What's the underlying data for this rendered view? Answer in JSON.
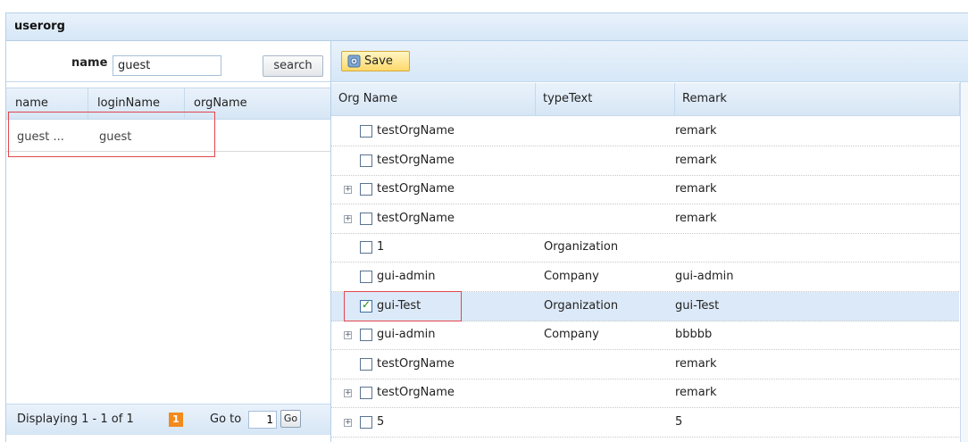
{
  "panel": {
    "title": "userorg"
  },
  "left": {
    "search": {
      "label": "name",
      "value": "guest",
      "button": "search"
    },
    "columns": [
      "name",
      "loginName",
      "orgName"
    ],
    "rows": [
      {
        "name": "guest ...",
        "loginName": "guest",
        "orgName": ""
      }
    ],
    "pager": {
      "displaying": "Displaying 1 - 1 of 1",
      "page": "1",
      "goto_label": "Go to",
      "goto_value": "1",
      "go_button": "Go"
    }
  },
  "right": {
    "toolbar": {
      "save_label": "Save"
    },
    "columns": [
      "Org Name",
      "typeText",
      "Remark"
    ],
    "rows": [
      {
        "name": "testOrgName",
        "type": "",
        "remark": "remark",
        "expandable": false,
        "checked": false
      },
      {
        "name": "testOrgName",
        "type": "",
        "remark": "remark",
        "expandable": false,
        "checked": false
      },
      {
        "name": "testOrgName",
        "type": "",
        "remark": "remark",
        "expandable": true,
        "checked": false
      },
      {
        "name": "testOrgName",
        "type": "",
        "remark": "remark",
        "expandable": true,
        "checked": false
      },
      {
        "name": "1",
        "type": "Organization",
        "remark": "",
        "expandable": false,
        "checked": false
      },
      {
        "name": "gui-admin",
        "type": "Company",
        "remark": "gui-admin",
        "expandable": false,
        "checked": false
      },
      {
        "name": "gui-Test",
        "type": "Organization",
        "remark": "gui-Test",
        "expandable": false,
        "checked": true
      },
      {
        "name": "gui-admin",
        "type": "Company",
        "remark": "bbbbb",
        "expandable": true,
        "checked": false
      },
      {
        "name": "testOrgName",
        "type": "",
        "remark": "remark",
        "expandable": false,
        "checked": false
      },
      {
        "name": "testOrgName",
        "type": "",
        "remark": "remark",
        "expandable": true,
        "checked": false
      },
      {
        "name": "5",
        "type": "",
        "remark": "5",
        "expandable": true,
        "checked": false
      }
    ]
  },
  "colors": {
    "header_bg": "#d6e7f7",
    "selected_row": "#dce9f8",
    "highlight_box": "#e2474b",
    "page_badge": "#f28a1d",
    "save_btn": "#ffd96a"
  }
}
